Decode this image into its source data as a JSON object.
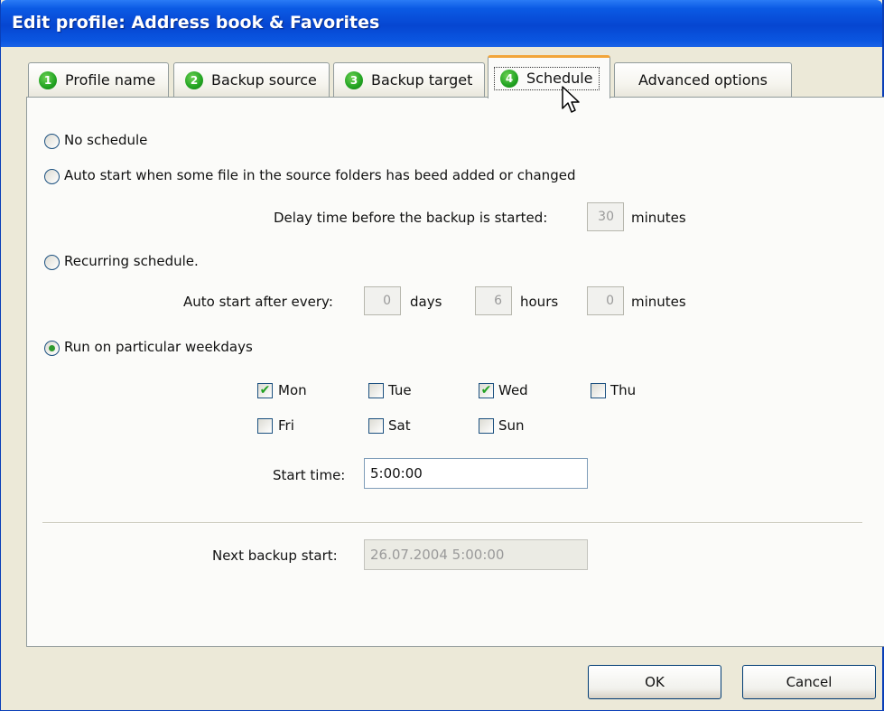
{
  "window": {
    "title": "Edit profile: Address book & Favorites"
  },
  "tabs": [
    {
      "num": "1",
      "label": "Profile name"
    },
    {
      "num": "2",
      "label": "Backup source"
    },
    {
      "num": "3",
      "label": "Backup target"
    },
    {
      "num": "4",
      "label": "Schedule",
      "active": true
    },
    {
      "num": "",
      "label": "Advanced options"
    }
  ],
  "schedule": {
    "no_schedule": "No schedule",
    "auto_start": "Auto start when some file in the source folders has beed added or changed",
    "delay_label": "Delay time before the backup is started:",
    "delay_value": "30",
    "delay_unit": "minutes",
    "recurring": "Recurring schedule.",
    "auto_every_label": "Auto start after every:",
    "days_value": "0",
    "days_label": "days",
    "hours_value": "6",
    "hours_label": "hours",
    "minutes_value": "0",
    "minutes_label": "minutes",
    "weekdays": "Run on particular weekdays",
    "selected_option": "Run on particular weekdays",
    "days": [
      {
        "label": "Mon",
        "checked": true
      },
      {
        "label": "Tue",
        "checked": false
      },
      {
        "label": "Wed",
        "checked": true
      },
      {
        "label": "Thu",
        "checked": false
      },
      {
        "label": "Fri",
        "checked": false
      },
      {
        "label": "Sat",
        "checked": false
      },
      {
        "label": "Sun",
        "checked": false
      }
    ],
    "start_time_label": "Start time:",
    "start_time_value": "5:00:00",
    "next_backup_label": "Next backup start:",
    "next_backup_value": "26.07.2004 5:00:00"
  },
  "buttons": {
    "ok": "OK",
    "cancel": "Cancel"
  },
  "colors": {
    "titlebar": "#0646d1",
    "active_tab_accent": "#f2a53a",
    "step_badge": "#21a321",
    "check_mark": "#21a121"
  }
}
